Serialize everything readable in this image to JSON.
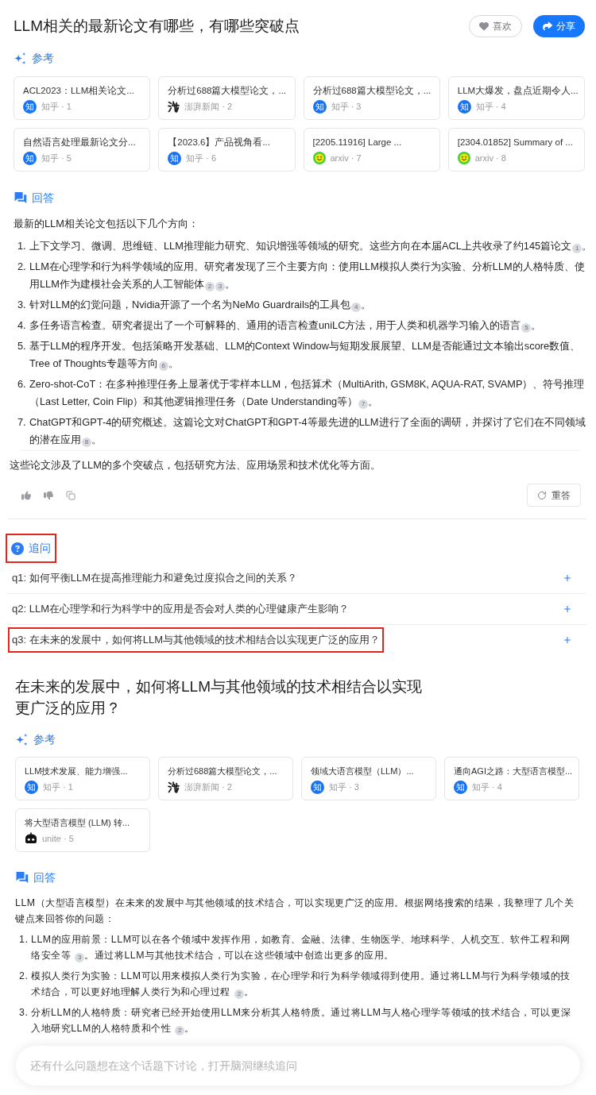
{
  "threads": [
    {
      "title": "LLM相关的最新论文有哪些，有哪些突破点",
      "buttons": [
        {
          "kind": "like",
          "label": "喜欢"
        },
        {
          "kind": "share",
          "label": "分享"
        }
      ],
      "references": {
        "heading": "参考",
        "items": [
          {
            "title": "ACL2023：LLM相关论文...",
            "logo": {
              "kind": "letter",
              "text": "知"
            },
            "source": "知乎 · 1"
          },
          {
            "title": "分析过688篇大模型论文，...",
            "logo": {
              "kind": "ink"
            },
            "source": "澎湃新闻 · 2"
          },
          {
            "title": "分析过688篇大模型论文，...",
            "logo": {
              "kind": "letter",
              "text": "知"
            },
            "source": "知乎 · 3"
          },
          {
            "title": "LLM大爆发，盘点近期令人...",
            "logo": {
              "kind": "letter",
              "text": "知"
            },
            "source": "知乎 · 4"
          },
          {
            "title": "自然语言处理最新论文分...",
            "logo": {
              "kind": "letter",
              "text": "知"
            },
            "source": "知乎 · 5"
          },
          {
            "title": "【2023.6】产品视角看...",
            "logo": {
              "kind": "letter",
              "text": "知"
            },
            "source": "知乎 · 6"
          },
          {
            "title": "[2205.11916] Large ...",
            "logo": {
              "kind": "smiley"
            },
            "source": "arxiv · 7"
          },
          {
            "title": "[2304.01852] Summary of ...",
            "logo": {
              "kind": "smiley"
            },
            "source": "arxiv · 8"
          }
        ]
      },
      "answer": {
        "heading": "回答",
        "intro": "最新的LLM相关论文包括以下几个方向：",
        "items": [
          {
            "number": "1.",
            "segments": [
              {
                "kind": "text",
                "text": "上下文学习、微调、思维链、LLM推理能力研究、知识增强等领域的研究。这些方向在本届ACL上共收录了约145篇论文"
              },
              {
                "kind": "cite",
                "text": "1"
              },
              {
                "kind": "text",
                "text": "。"
              }
            ]
          },
          {
            "number": "2.",
            "segments": [
              {
                "kind": "text",
                "text": "LLM在心理学和行为科学领域的应用。研究者发现了三个主要方向：使用LLM模拟人类行为实验、分析LLM的人格特质、使用LLM作为建模社会关系的人工智能体"
              },
              {
                "kind": "cite",
                "text": "2"
              },
              {
                "kind": "cite",
                "text": "3"
              },
              {
                "kind": "text",
                "text": "。"
              }
            ]
          },
          {
            "number": "3.",
            "segments": [
              {
                "kind": "text",
                "text": "针对LLM的幻觉问题，Nvidia开源了一个名为NeMo Guardrails的工具包"
              },
              {
                "kind": "cite",
                "text": "4"
              },
              {
                "kind": "text",
                "text": "。"
              }
            ]
          },
          {
            "number": "4.",
            "segments": [
              {
                "kind": "text",
                "text": "多任务语言检查。研究者提出了一个可解释的、通用的语言检查uniLC方法，用于人类和机器学习输入的语言"
              },
              {
                "kind": "cite",
                "text": "5"
              },
              {
                "kind": "text",
                "text": "。"
              }
            ]
          },
          {
            "number": "5.",
            "segments": [
              {
                "kind": "text",
                "text": "基于LLM的程序开发。包括策略开发基础、LLM的Context Window与短期发展展望、LLM是否能通过文本输出score数值、Tree of Thoughts专题等方向"
              },
              {
                "kind": "cite",
                "text": "6"
              },
              {
                "kind": "text",
                "text": "。"
              }
            ]
          },
          {
            "number": "6.",
            "segments": [
              {
                "kind": "text",
                "text": "Zero-shot-CoT：在多种推理任务上显著优于零样本LLM，包括算术（MultiArith, GSM8K, AQUA-RAT, SVAMP）、符号推理（Last Letter, Coin Flip）和其他逻辑推理任务（Date Understanding等）"
              },
              {
                "kind": "cite",
                "text": "7"
              },
              {
                "kind": "text",
                "text": "。"
              }
            ]
          },
          {
            "number": "7.",
            "segments": [
              {
                "kind": "text",
                "text": "ChatGPT和GPT-4的研究概述。这篇论文对ChatGPT和GPT-4等最先进的LLM进行了全面的调研，并探讨了它们在不同领域的潜在应用"
              },
              {
                "kind": "cite",
                "text": "8"
              },
              {
                "kind": "text",
                "text": "。"
              }
            ]
          }
        ],
        "conclusion": "这些论文涉及了LLM的多个突破点，包括研究方法、应用场景和技术优化等方面。"
      },
      "retry_button": "重答",
      "follow_up": {
        "heading": "追问",
        "highlighted": true,
        "items": [
          {
            "text": "q1: 如何平衡LLM在提高推理能力和避免过度拟合之间的关系？",
            "highlighted": false
          },
          {
            "text": "q2: LLM在心理学和行为科学中的应用是否会对人类的心理健康产生影响？",
            "highlighted": false
          },
          {
            "text": "q3: 在未来的发展中，如何将LLM与其他领域的技术相结合以实现更广泛的应用？",
            "highlighted": true
          }
        ]
      }
    },
    {
      "title": "在未来的发展中，如何将LLM与其他领域的技术相结合以实现更广泛的应用？",
      "references": {
        "heading": "参考",
        "items": [
          {
            "title": "LLM技术发展、能力增强...",
            "logo": {
              "kind": "letter",
              "text": "知"
            },
            "source": "知乎 · 1"
          },
          {
            "title": "分析过688篇大模型论文，...",
            "logo": {
              "kind": "ink"
            },
            "source": "澎湃新闻 · 2"
          },
          {
            "title": "领域大语言模型（LLM）...",
            "logo": {
              "kind": "letter",
              "text": "知"
            },
            "source": "知乎 · 3"
          },
          {
            "title": "通向AGI之路：大型语言模型...",
            "logo": {
              "kind": "letter",
              "text": "知"
            },
            "source": "知乎 · 4"
          },
          {
            "title": "将大型语言模型 (LLM) 转...",
            "logo": {
              "kind": "robot"
            },
            "source": "unite · 5"
          }
        ]
      },
      "answer": {
        "heading": "回答",
        "intro": "LLM（大型语言模型）在未来的发展中与其他领域的技术结合，可以实现更广泛的应用。根据网络搜索的结果，我整理了几个关键点来回答你的问题：",
        "items": [
          {
            "number": "1.",
            "segments": [
              {
                "kind": "text",
                "text": "LLM的应用前景：LLM可以在各个领域中发挥作用，如教育、金融、法律、生物医学、地球科学、人机交互、软件工程和网络安全等"
              },
              {
                "kind": "cite",
                "text": "3"
              },
              {
                "kind": "text",
                "text": "。通过将LLM与其他技术结合，可以在这些领域中创造出更多的应用。"
              }
            ]
          },
          {
            "number": "2.",
            "segments": [
              {
                "kind": "text",
                "text": "模拟人类行为实验：LLM可以用来模拟人类行为实验，在心理学和行为科学领域得到使用。通过将LLM与行为科学领域的技术结合，可以更好地理解人类行为和心理过程"
              },
              {
                "kind": "cite",
                "text": "2"
              },
              {
                "kind": "text",
                "text": "。"
              }
            ]
          },
          {
            "number": "3.",
            "segments": [
              {
                "kind": "text",
                "text": "分析LLM的人格特质：研究者已经开始使用LLM来分析其人格特质。通过将LLM与人格心理学等领域的技术结合，可以更深入地研究LLM的人格特质和个性"
              },
              {
                "kind": "cite",
                "text": "2"
              },
              {
                "kind": "text",
                "text": "。"
              }
            ]
          }
        ]
      }
    }
  ],
  "input": {
    "placeholder": "还有什么问题想在这个话题下讨论，打开脑洞继续追问"
  }
}
